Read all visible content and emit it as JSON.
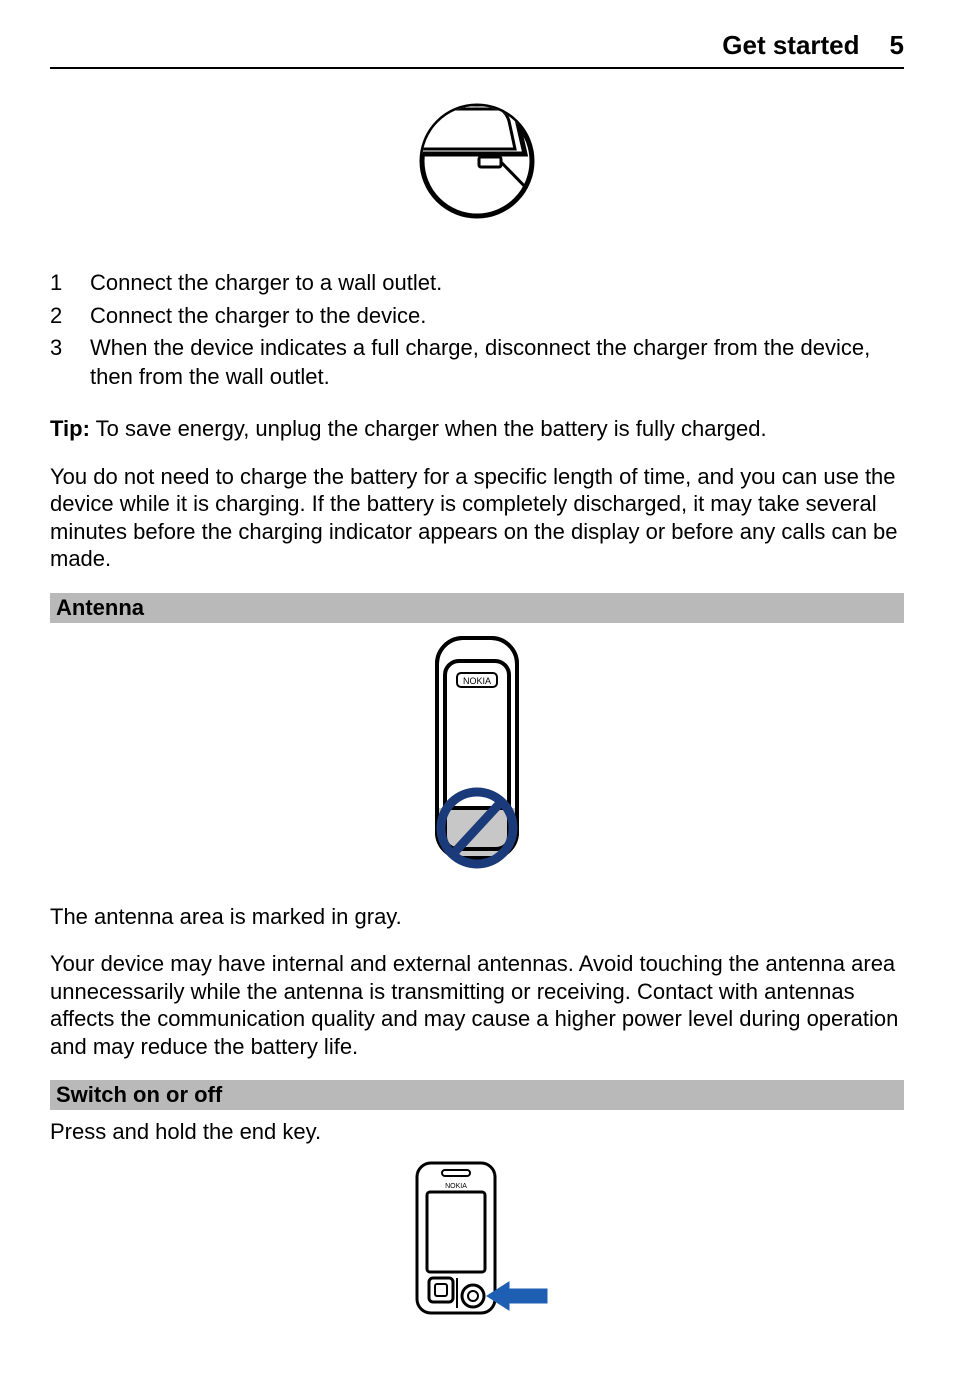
{
  "header": {
    "title": "Get started",
    "page": "5"
  },
  "steps": [
    {
      "num": "1",
      "text": "Connect the charger to a wall outlet."
    },
    {
      "num": "2",
      "text": "Connect the charger to the device."
    },
    {
      "num": "3",
      "text": "When the device indicates a full charge, disconnect the charger from the device, then from the wall outlet."
    }
  ],
  "tip": {
    "label": "Tip:",
    "text": " To save energy, unplug the charger when the battery is fully charged."
  },
  "charge_para": "You do not need to charge the battery for a specific length of time, and you can use the device while it is charging. If the battery is completely discharged, it may take several minutes before the charging indicator appears on the display or before any calls can be made.",
  "sections": {
    "antenna": {
      "heading": "Antenna",
      "caption": "The antenna area is marked in gray.",
      "body": "Your device may have internal and external antennas. Avoid touching the antenna area unnecessarily while the antenna is transmitting or receiving. Contact with antennas affects the communication quality and may cause a higher power level during operation and may reduce the battery life."
    },
    "switch": {
      "heading": "Switch on or off",
      "body": "Press and hold the end key."
    }
  },
  "figure_labels": {
    "nokia": "NOKIA"
  }
}
